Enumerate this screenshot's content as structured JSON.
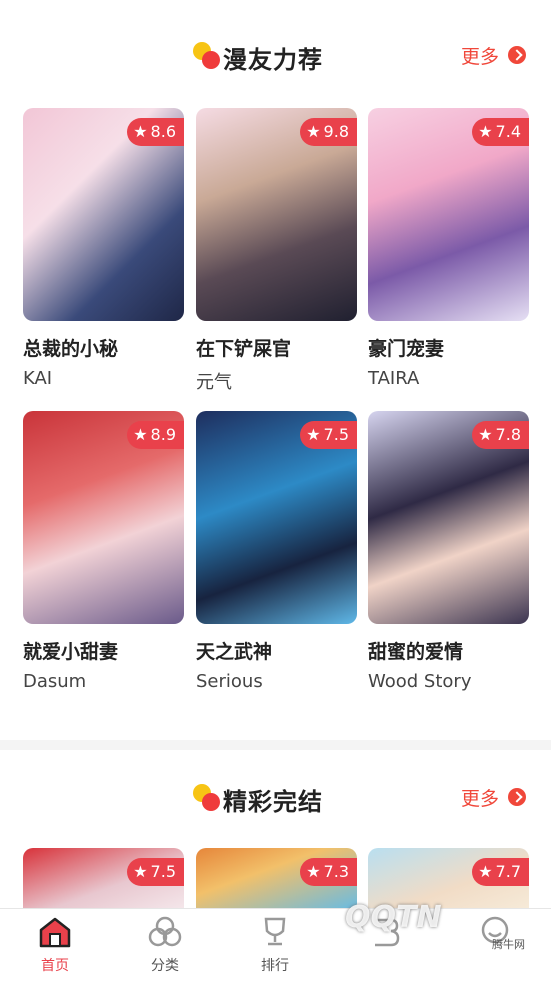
{
  "sections": [
    {
      "title": "漫友力荐",
      "more": "更多"
    },
    {
      "title": "精彩完结",
      "more": "更多"
    }
  ],
  "recommend": [
    {
      "name": "总裁的小秘",
      "author": "KAI",
      "rating": "8.6",
      "bg1": "#f2c6d6",
      "bg2": "#3a4a7a"
    },
    {
      "name": "在下铲屎官",
      "author": "元气",
      "rating": "9.8",
      "bg1": "#f5dbe3",
      "bg2": "#5a4a55"
    },
    {
      "name": "豪门宠妻",
      "author": "TAIRA",
      "rating": "7.4",
      "bg1": "#f7d0e2",
      "bg2": "#7b5aa8"
    },
    {
      "name": "就爱小甜妻",
      "author": "Dasum",
      "rating": "8.9",
      "bg1": "#c9343a",
      "bg2": "#f2d2d6"
    },
    {
      "name": "天之武神",
      "author": "Serious",
      "rating": "7.5",
      "bg1": "#1e2e5e",
      "bg2": "#2d8ac6"
    },
    {
      "name": "甜蜜的爱情",
      "author": "Wood Story",
      "rating": "7.8",
      "bg1": "#d6d4ef",
      "bg2": "#2f2a45"
    }
  ],
  "completed": [
    {
      "rating": "7.5",
      "bg1": "#d8323a",
      "bg2": "#e8c7cf"
    },
    {
      "rating": "7.3",
      "bg1": "#e6863a",
      "bg2": "#6bbbe0"
    },
    {
      "rating": "7.7",
      "bg1": "#b9dff0",
      "bg2": "#f1dcc6"
    }
  ],
  "tabs": [
    {
      "label": "首页",
      "icon": "home-icon",
      "active": true
    },
    {
      "label": "分类",
      "icon": "category-icon",
      "active": false
    },
    {
      "label": "排行",
      "icon": "trophy-icon",
      "active": false
    },
    {
      "label": "",
      "icon": "bookshelf-icon",
      "active": false
    },
    {
      "label": "",
      "icon": "profile-icon",
      "active": false
    }
  ],
  "watermark": {
    "main": "QQTN",
    "small": "腾牛网"
  },
  "colors": {
    "accent": "#e9414b",
    "logo_yellow": "#f7c414",
    "logo_red": "#ef3b3b"
  }
}
